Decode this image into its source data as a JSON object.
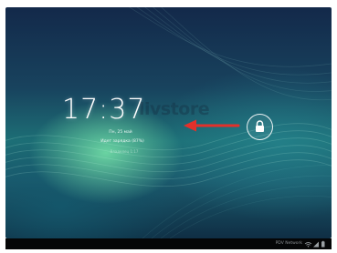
{
  "lockscreen": {
    "time": "17:37",
    "date": "Пн, 25 май",
    "battery_status": "Идет зарядка (87%)",
    "owner_info": "Владелец 1:17",
    "watermark": "livstore"
  },
  "unlock": {
    "icon": "lock-icon",
    "hint_arrow": "red-arrow-left"
  },
  "status_bar": {
    "text": "PDV Network",
    "icons": [
      "wifi-icon",
      "signal-icon",
      "battery-icon"
    ]
  },
  "colors": {
    "arrow": "#e3302a",
    "ring": "#ffffff",
    "status_bar": "#050607"
  }
}
